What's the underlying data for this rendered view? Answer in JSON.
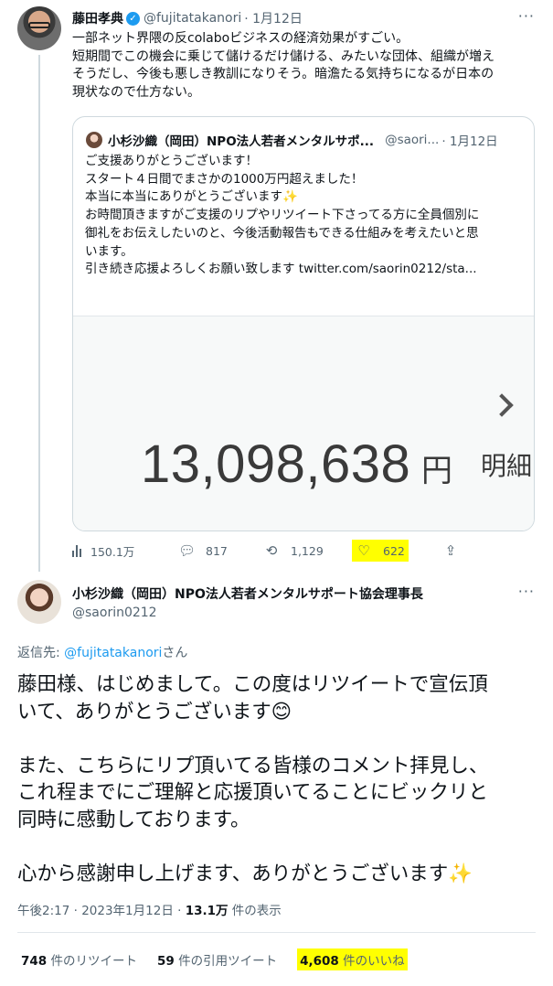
{
  "tweet1": {
    "name": "藤田孝典",
    "handle": "@fujitatakanori",
    "date": "· 1月12日",
    "lines": [
      "一部ネット界隈の反colaboビジネスの経済効果がすごい。",
      "短期間でこの機会に乗じて儲けるだけ儲ける、みたいな団体、組織が増え",
      "そうだし、今後も悪しき教訓になりそう。暗澹たる気持ちになるが日本の",
      "現状なので仕方ない。"
    ],
    "quote": {
      "name": "小杉沙織（岡田）NPO法人若者メンタルサポ...",
      "handle": "@saori...",
      "date": "· 1月12日",
      "lines": [
        "ご支援ありがとうございます！",
        "スタート４日間でまさかの1000万円超えました！",
        "本当に本当にありがとうございます✨",
        "お時間頂きますがご支援のリプやリツイート下さってる方に全員個別に",
        "御礼をお伝えしたいのと、今後活動報告もできる仕組みを考えたいと思",
        "います。",
        "引き続き応援よろしくお願い致します  twitter.com/saorin0212/sta..."
      ],
      "image": {
        "amount": "13,098,638",
        "yen": "円",
        "side_label": "明細"
      }
    },
    "actions": {
      "views": "150.1万",
      "replies": "817",
      "retweets": "1,129",
      "likes": "622"
    }
  },
  "tweet2": {
    "name": "小杉沙織（岡田）NPO法人若者メンタルサポート協会理事長",
    "handle": "@saorin0212",
    "replying_prefix": "返信先: ",
    "replying_mention": "@fujitatakanori",
    "replying_suffix": "さん",
    "paragraphs": [
      [
        "藤田様、はじめまして。この度はリツイートで宣伝頂",
        "いて、ありがとうございます😊"
      ],
      [
        "また、こちらにリプ頂いてる皆様のコメント拝見し、",
        "これ程までにご理解と応援頂いてることにビックリと",
        "同時に感動しております。"
      ],
      [
        "心から感謝申し上げます、ありがとうございます✨"
      ]
    ],
    "meta": {
      "time": "午後2:17 · 2023年1月12日 · ",
      "views": "13.1万",
      "views_suffix": " 件の表示"
    },
    "stats": {
      "retweets": "748",
      "retweets_label": " 件のリツイート",
      "quotes": "59",
      "quotes_label": " 件の引用ツイート",
      "likes": "4,608",
      "likes_label": " 件のいいね"
    }
  }
}
